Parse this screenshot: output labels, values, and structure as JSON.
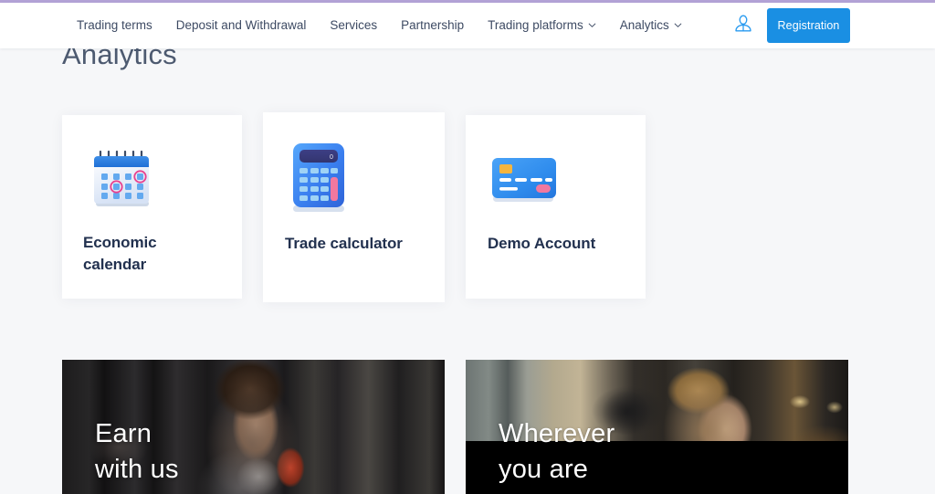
{
  "theme": {
    "top_rule_color": "#b3a2d6",
    "accent_color": "#1a8fe3",
    "page_background": "#f6f7f9",
    "card_background": "#ffffff",
    "nav_text_color": "#3d4a63",
    "heading_color": "#22314f"
  },
  "header": {
    "nav_items": [
      {
        "label": "Trading terms",
        "has_dropdown": false
      },
      {
        "label": "Deposit and Withdrawal",
        "has_dropdown": false
      },
      {
        "label": "Services",
        "has_dropdown": false
      },
      {
        "label": "Partnership",
        "has_dropdown": false
      },
      {
        "label": "Trading platforms",
        "has_dropdown": true
      },
      {
        "label": "Analytics",
        "has_dropdown": true
      }
    ],
    "account_icon": "user-account-icon",
    "registration_label": "Registration"
  },
  "page": {
    "title": "Analytics"
  },
  "cards": [
    {
      "label": "Economic\ncalendar",
      "icon": "calendar-icon"
    },
    {
      "label": "Trade\ncalculator",
      "icon": "calculator-icon"
    },
    {
      "label": "Demo Account",
      "icon": "credit-card-icon"
    }
  ],
  "banners": [
    {
      "title": "Earn\nwith us",
      "image": "man-with-coffee-photo"
    },
    {
      "title": "Wherever\nyou are",
      "image": "man-in-cafe-photo"
    }
  ]
}
